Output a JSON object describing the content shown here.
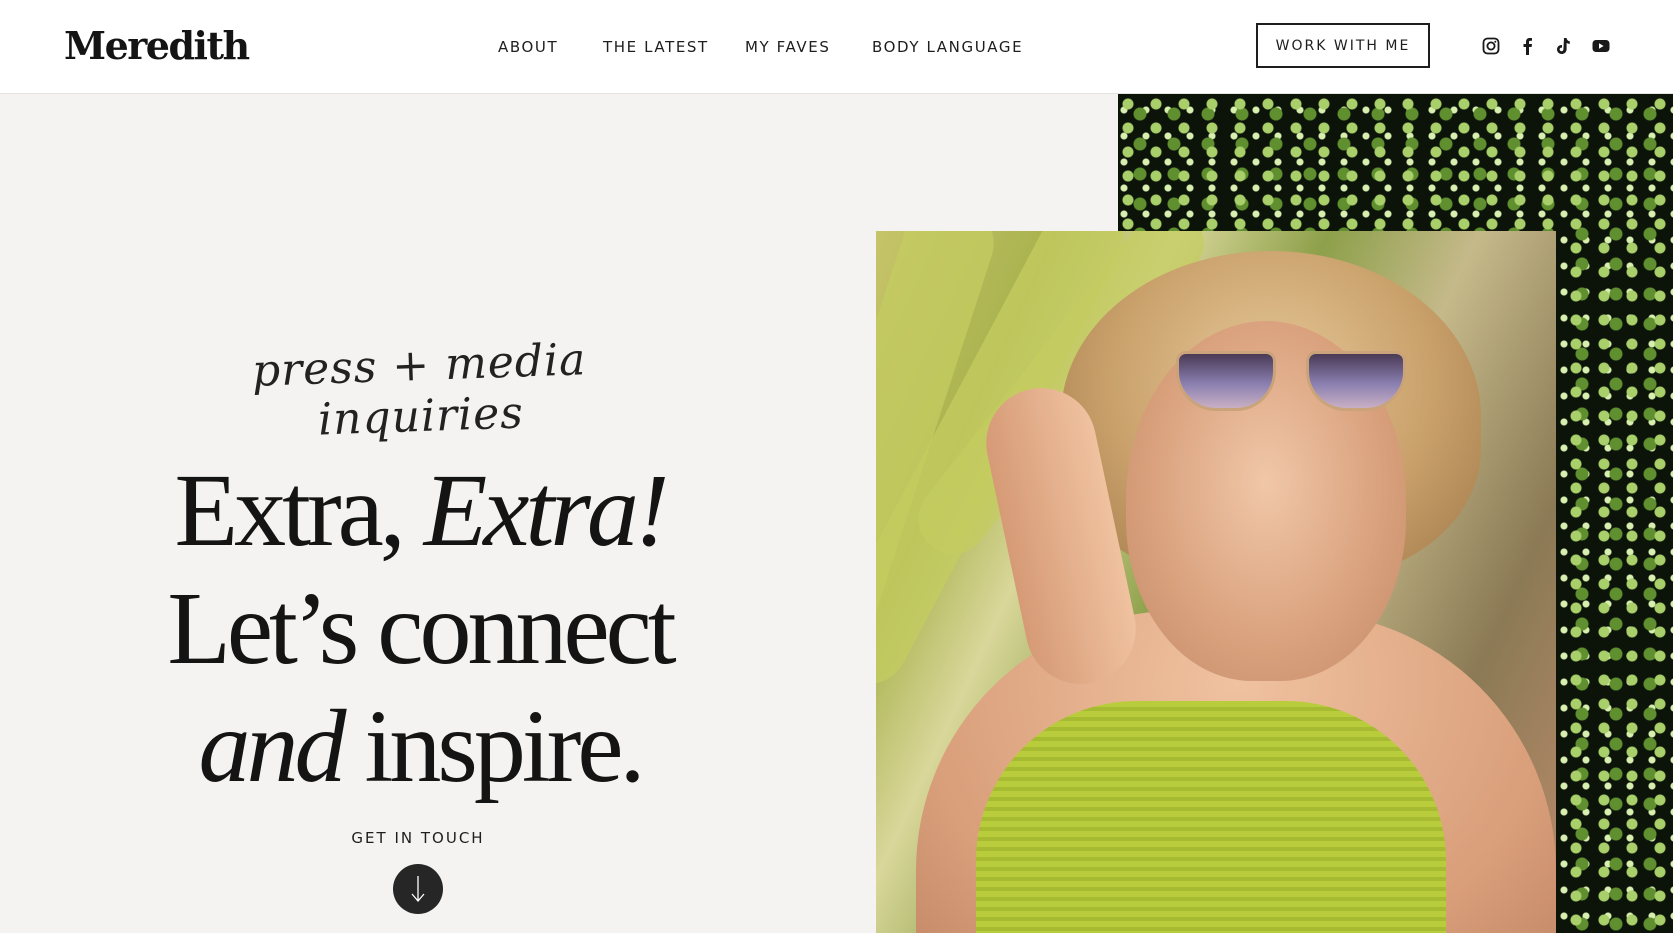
{
  "header": {
    "logo": "Meredith",
    "nav": [
      {
        "label": "ABOUT"
      },
      {
        "label": "THE LATEST"
      },
      {
        "label": "MY FAVES"
      },
      {
        "label": "BODY LANGUAGE"
      }
    ],
    "cta_label": "WORK WITH ME",
    "social_icons": [
      "instagram-icon",
      "facebook-icon",
      "tiktok-icon",
      "youtube-icon"
    ]
  },
  "hero": {
    "script_text": "press + media inquiries",
    "headline": {
      "line1_regular": "Extra, ",
      "line1_italic": "Extra!",
      "line2": "Let’s connect",
      "line3_italic": "and",
      "line3_regular": " inspire."
    },
    "get_in_touch": "GET IN TOUCH",
    "down_arrow_icon": "arrow-down-icon"
  },
  "colors": {
    "background": "#f4f3f1",
    "header_bg": "#ffffff",
    "text": "#141414",
    "button_dark": "#262626",
    "dress_green": "#b9cc3c"
  }
}
